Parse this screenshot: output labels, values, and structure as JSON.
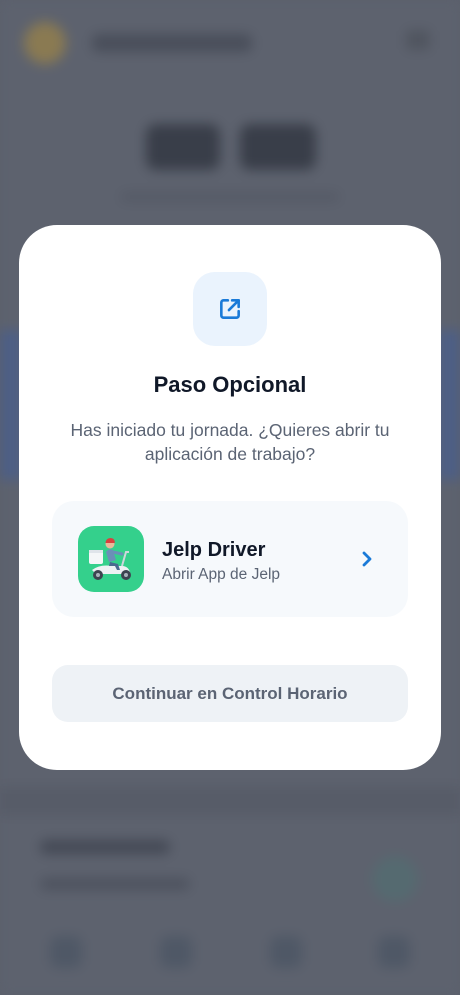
{
  "modal": {
    "icon": "external-link-icon",
    "title": "Paso Opcional",
    "description": "Has iniciado tu jornada. ¿Quieres abrir tu aplicación de trabajo?",
    "app_option": {
      "icon": "delivery-scooter-icon",
      "name": "Jelp Driver",
      "subtitle": "Abrir App de Jelp",
      "chevron": "chevron-right-icon"
    },
    "continue_label": "Continuar en Control Horario"
  },
  "colors": {
    "accent": "#1a7ad8",
    "app_icon_bg": "#34d08c",
    "overlay": "#5b606c"
  }
}
